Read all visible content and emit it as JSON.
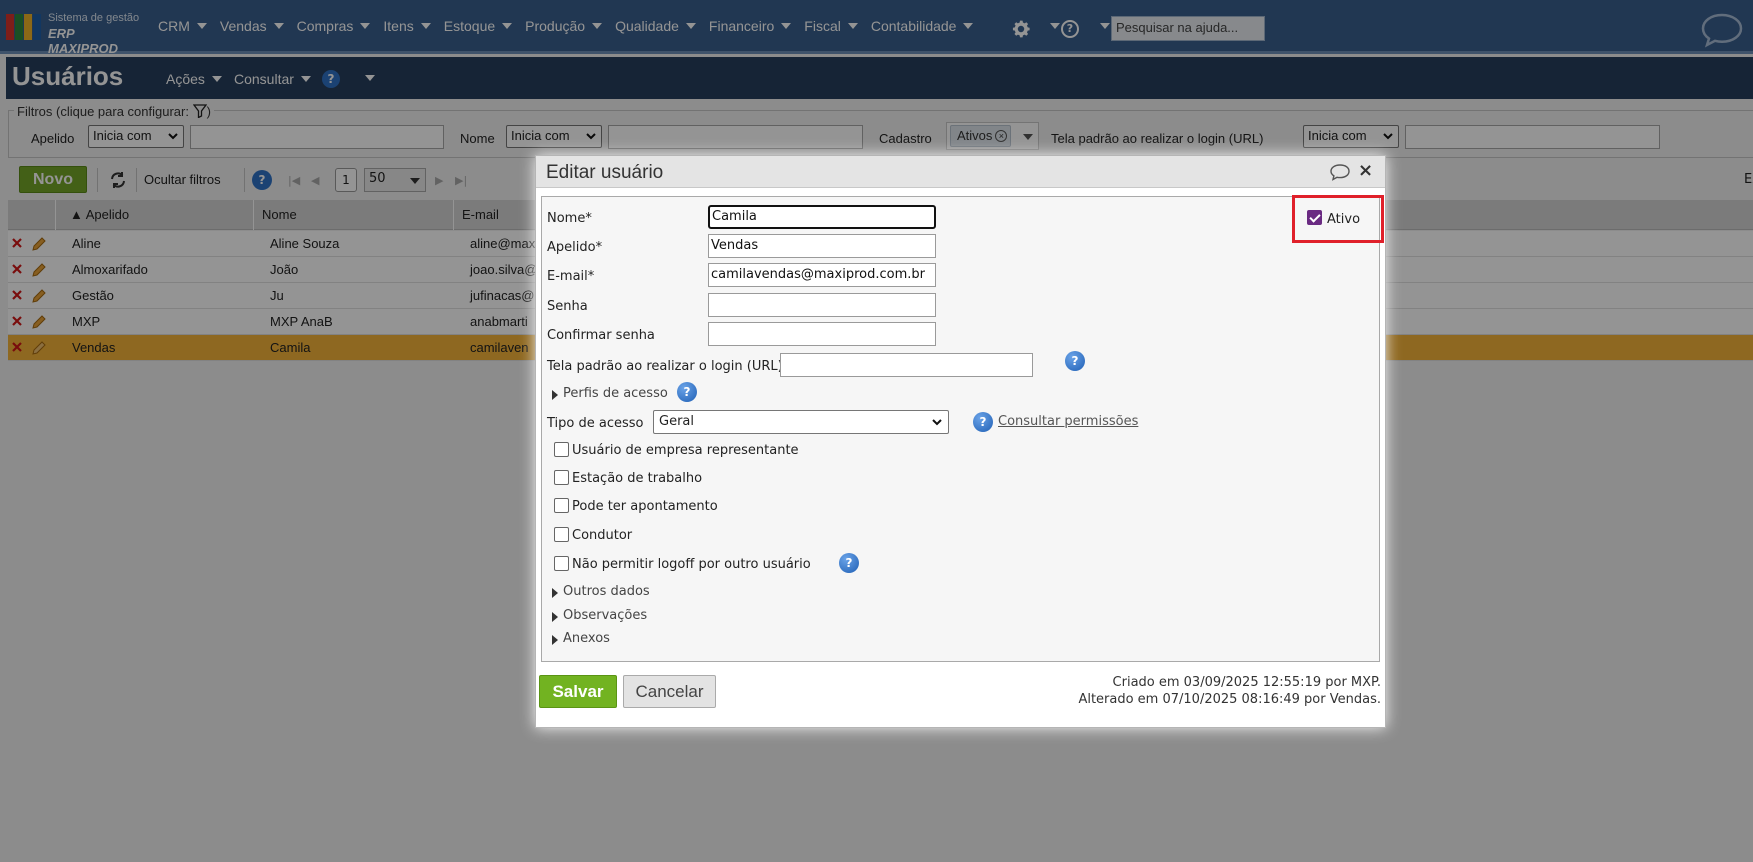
{
  "app": {
    "logo_line1": "Sistema de gestão",
    "logo_line2": "ERP MAXIPROD",
    "menu": [
      "CRM",
      "Vendas",
      "Compras",
      "Itens",
      "Estoque",
      "Produção",
      "Qualidade",
      "Financeiro",
      "Fiscal",
      "Contabilidade"
    ],
    "help_search_placeholder": "Pesquisar na ajuda...",
    "colors": {
      "topbar": "#3a5f8d",
      "header": "#263f5e",
      "accent_green": "#72b321",
      "highlight_row": "#f5b43a",
      "callout_red": "#e0202a"
    }
  },
  "page": {
    "title": "Usuários",
    "actions_label": "Ações",
    "consult_label": "Consultar",
    "help_glyph": "?"
  },
  "filters": {
    "legend": "Filtros (clique para configurar:",
    "legend_close": ")",
    "apelido_label": "Apelido",
    "apelido_op": "Inicia com",
    "nome_label": "Nome",
    "nome_op": "Inicia com",
    "cadastro_label": "Cadastro",
    "cadastro_chip": "Ativos",
    "tela_label": "Tela padrão ao realizar o login (URL)",
    "tela_op": "Inicia com"
  },
  "toolbar": {
    "novo_label": "Novo",
    "ocultar_label": "Ocultar filtros",
    "page_number": "1",
    "per_page": "50",
    "export_cut": "Ex"
  },
  "grid": {
    "columns": [
      "Apelido",
      "Nome",
      "E-mail"
    ],
    "rows": [
      {
        "apelido": "Aline",
        "nome": "Aline Souza",
        "email": "aline@max"
      },
      {
        "apelido": "Almoxarifado",
        "nome": "João",
        "email": "joao.silva@"
      },
      {
        "apelido": "Gestão",
        "nome": "Ju",
        "email": "jufinacas@"
      },
      {
        "apelido": "MXP",
        "nome": "MXP AnaB",
        "email": "anabmarti"
      },
      {
        "apelido": "Vendas",
        "nome": "Camila",
        "email": "camilaven"
      }
    ],
    "selected_row": 4
  },
  "dialog": {
    "title": "Editar usuário",
    "close_glyph": "×",
    "ativo_label": "Ativo",
    "ativo_checked": true,
    "fields": {
      "nome_label": "Nome*",
      "nome_value": "Camila",
      "apelido_label": "Apelido*",
      "apelido_value": "Vendas",
      "email_label": "E-mail*",
      "email_value": "camilavendas@maxiprod.com.br",
      "senha_label": "Senha",
      "senha_value": "",
      "confirmar_label": "Confirmar senha",
      "confirmar_value": "",
      "tela_label": "Tela padrão ao realizar o login (URL)",
      "tela_value": ""
    },
    "perfis_label": "Perfis de acesso",
    "tipo_label": "Tipo de acesso",
    "tipo_value": "Geral",
    "consultar_permissoes": "Consultar permissões",
    "checkboxes": [
      {
        "label": "Usuário de empresa representante",
        "checked": false
      },
      {
        "label": "Estação de trabalho",
        "checked": false
      },
      {
        "label": "Pode ter apontamento",
        "checked": false
      },
      {
        "label": "Condutor",
        "checked": false
      },
      {
        "label": "Não permitir logoff por outro usuário",
        "checked": false
      }
    ],
    "sections": [
      "Outros dados",
      "Observações",
      "Anexos"
    ],
    "salvar_label": "Salvar",
    "cancelar_label": "Cancelar",
    "criado": "Criado em 03/09/2025 12:55:19 por MXP.",
    "alterado": "Alterado em 07/10/2025 08:16:49 por Vendas."
  }
}
